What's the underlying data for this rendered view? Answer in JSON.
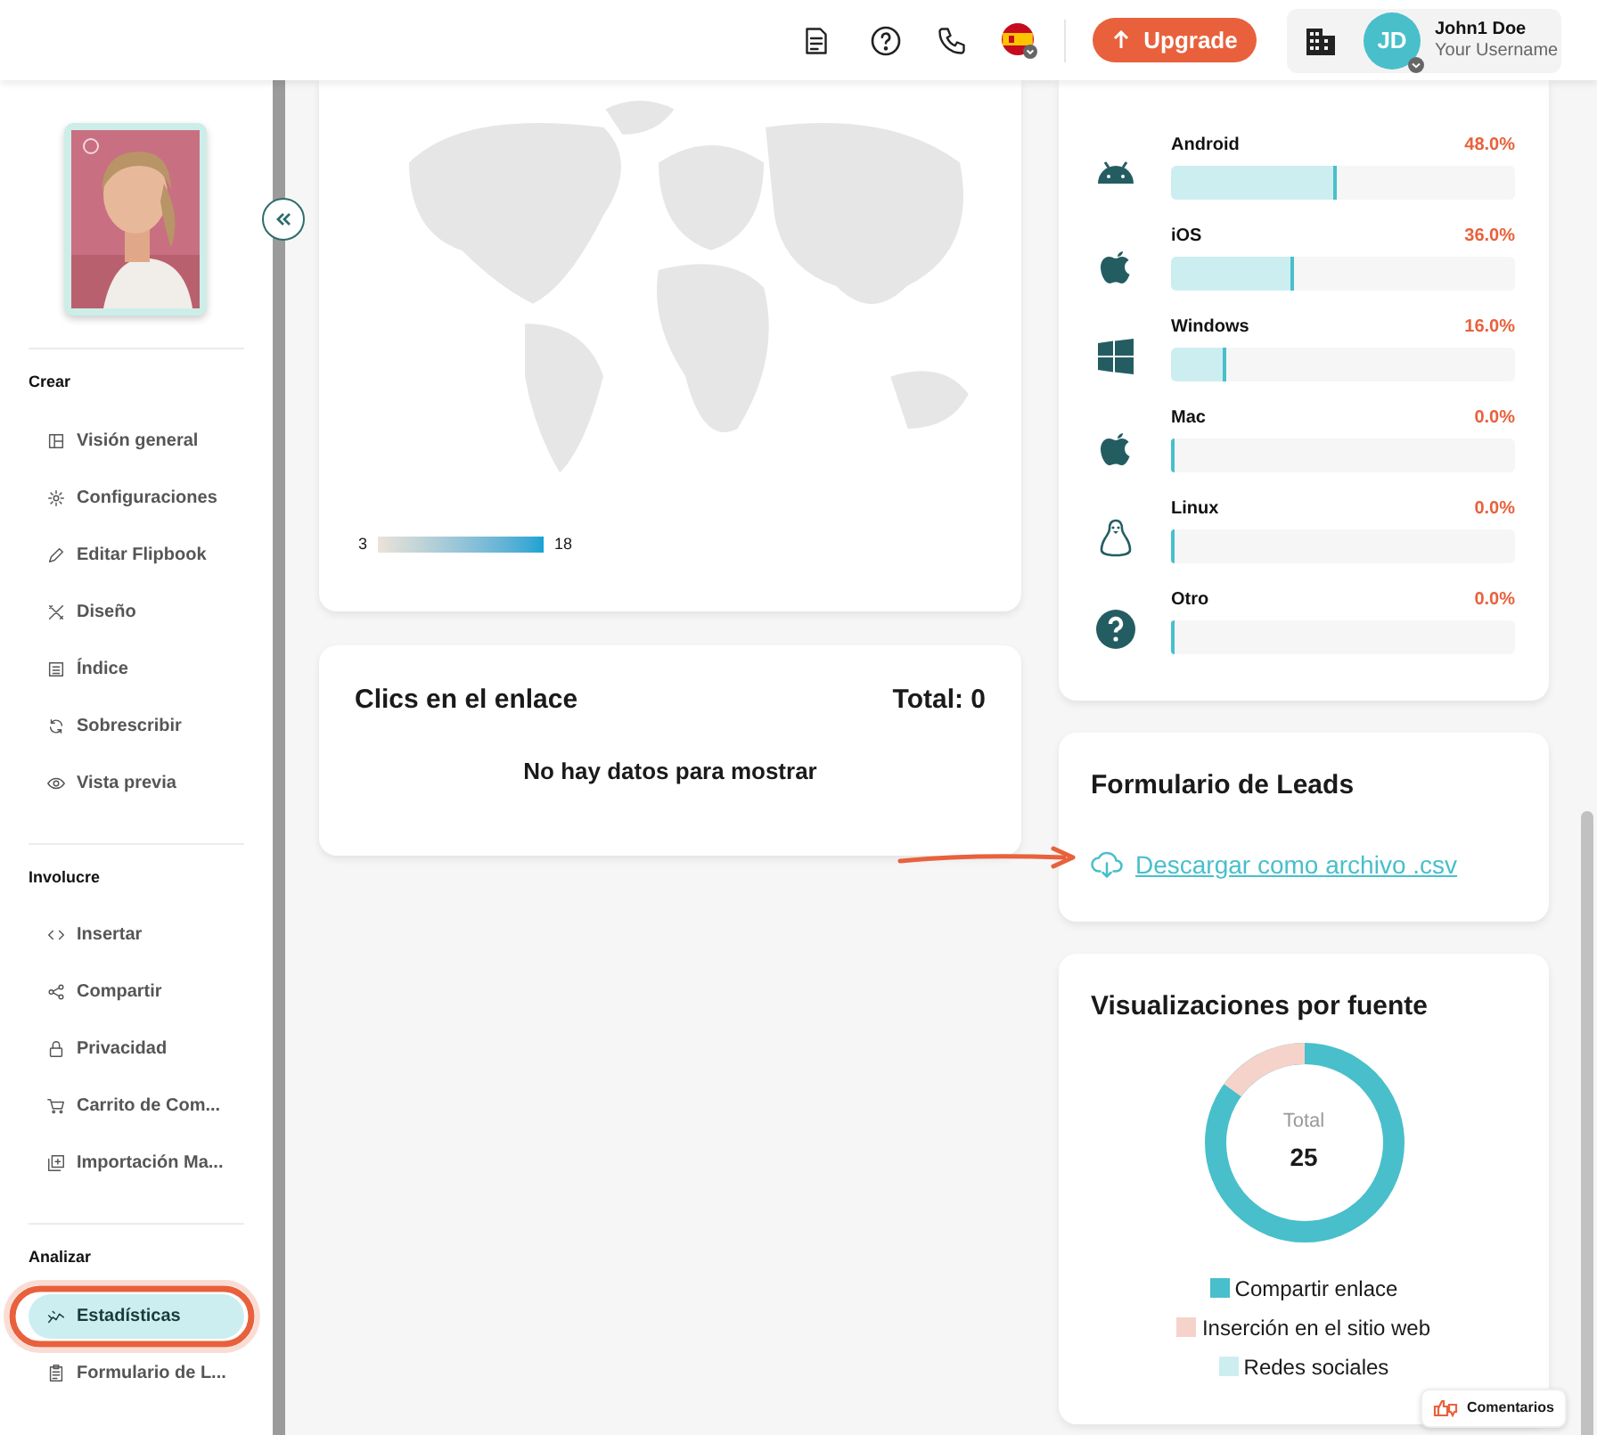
{
  "header": {
    "upgrade_button": "Upgrade",
    "avatar_initials": "JD",
    "user_name": "John1 Doe",
    "user_subtitle": "Your Username"
  },
  "sidebar": {
    "sections": [
      {
        "title": "Crear",
        "items": [
          {
            "label": "Visión general",
            "selected": false
          },
          {
            "label": "Configuraciones",
            "selected": false
          },
          {
            "label": "Editar Flipbook",
            "selected": false
          },
          {
            "label": "Diseño",
            "selected": false
          },
          {
            "label": "Índice",
            "selected": false
          },
          {
            "label": "Sobrescribir",
            "selected": false
          },
          {
            "label": "Vista previa",
            "selected": false
          }
        ]
      },
      {
        "title": "Involucre",
        "items": [
          {
            "label": "Insertar",
            "selected": false
          },
          {
            "label": "Compartir",
            "selected": false
          },
          {
            "label": "Privacidad",
            "selected": false
          },
          {
            "label": "Carrito de Com...",
            "selected": false
          },
          {
            "label": "Importación Ma...",
            "selected": false
          }
        ]
      },
      {
        "title": "Analizar",
        "items": [
          {
            "label": "Estadísticas",
            "selected": true
          },
          {
            "label": "Formulario de L...",
            "selected": false
          }
        ]
      }
    ]
  },
  "map_card": {
    "legend_min": "3",
    "legend_max": "18"
  },
  "clicks_card": {
    "title": "Clics en el enlace",
    "total": "Total: 0",
    "empty_message": "No hay datos para mostrar"
  },
  "os_card": {
    "rows": [
      {
        "name": "Android",
        "percent": "48.0%",
        "level": 0.48
      },
      {
        "name": "iOS",
        "percent": "36.0%",
        "level": 0.36
      },
      {
        "name": "Windows",
        "percent": "16.0%",
        "level": 0.16
      },
      {
        "name": "Mac",
        "percent": "0.0%",
        "level": 0
      },
      {
        "name": "Linux",
        "percent": "0.0%",
        "level": 0
      },
      {
        "name": "Otro",
        "percent": "0.0%",
        "level": 0
      }
    ]
  },
  "leads_card": {
    "title": "Formulario de Leads",
    "download_link": "Descargar como archivo .csv"
  },
  "sources_card": {
    "title": "Visualizaciones por fuente",
    "center_label": "Total",
    "center_value": "25",
    "legend": [
      {
        "label": "Compartir enlace",
        "color": "#48bfcb"
      },
      {
        "label": "Inserción en el sitio web",
        "color": "#f6d3ca"
      },
      {
        "label": "Redes sociales",
        "color": "#cdeef1"
      }
    ]
  },
  "feedback_button": "Comentarios"
}
